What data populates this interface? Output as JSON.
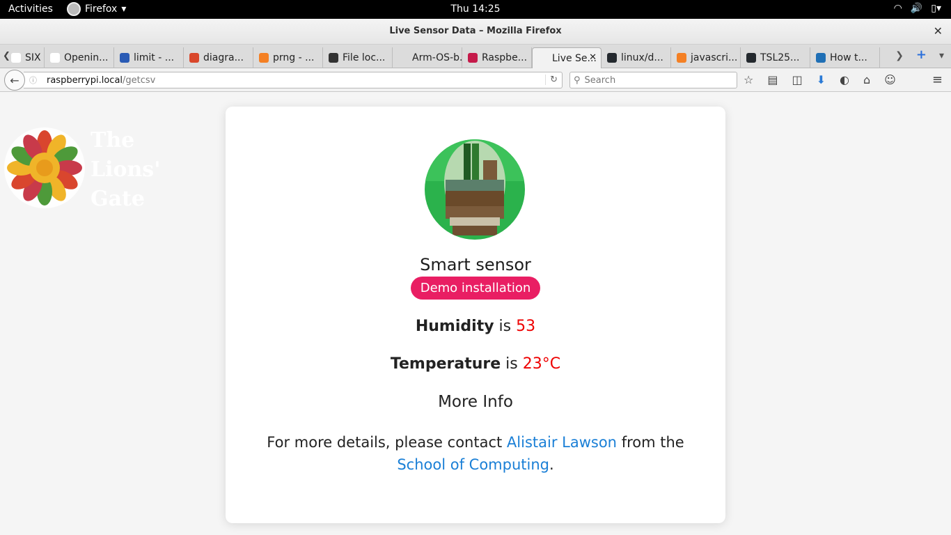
{
  "os_topbar": {
    "activities": "Activities",
    "app_name": "Firefox",
    "clock": "Thu 14:25"
  },
  "window": {
    "title": "Live Sensor Data – Mozilla Firefox",
    "close": "✕"
  },
  "tabs": [
    {
      "label": "SIX ...",
      "favicon_color": "#ffffff"
    },
    {
      "label": "Openin...",
      "favicon_color": "#ffffff"
    },
    {
      "label": "limit - ...",
      "favicon_color": "#2a5bb5"
    },
    {
      "label": "diagra...",
      "favicon_color": "#d9472b"
    },
    {
      "label": "prng - ...",
      "favicon_color": "#f48024"
    },
    {
      "label": "File loc...",
      "favicon_color": "#333333"
    },
    {
      "label": "Arm-OS-b...",
      "favicon_color": "#dcdcdc"
    },
    {
      "label": "Raspbe...",
      "favicon_color": "#c51a4a"
    },
    {
      "label": "Live Se...",
      "favicon_color": "#f2f2f2",
      "active": true
    },
    {
      "label": "linux/d...",
      "favicon_color": "#24292e"
    },
    {
      "label": "javascri...",
      "favicon_color": "#f48024"
    },
    {
      "label": "TSL25...",
      "favicon_color": "#24292e"
    },
    {
      "label": "How t...",
      "favicon_color": "#1f6fb5"
    }
  ],
  "navbar": {
    "url_host": "raspberrypi.local",
    "url_path": "/getcsv",
    "search_placeholder": "Search"
  },
  "page": {
    "device_name": "Smart sensor",
    "badge": "Demo installation",
    "humidity_label": "Humidity",
    "is_word": "is",
    "humidity_value": "53",
    "temperature_label": "Temperature",
    "temperature_value": "23°C",
    "more_info_heading": "More Info",
    "contact_prefix": "For more details, please contact",
    "contact_name": "Alistair Lawson",
    "contact_middle": "from the",
    "contact_org": "School of Computing",
    "contact_suffix": ".",
    "bg_logo_text": [
      "The",
      "Lions'",
      "Gate"
    ]
  },
  "colors": {
    "badge": "#e91e63",
    "value_red": "#ee0000",
    "link_blue": "#1a7fd6"
  }
}
